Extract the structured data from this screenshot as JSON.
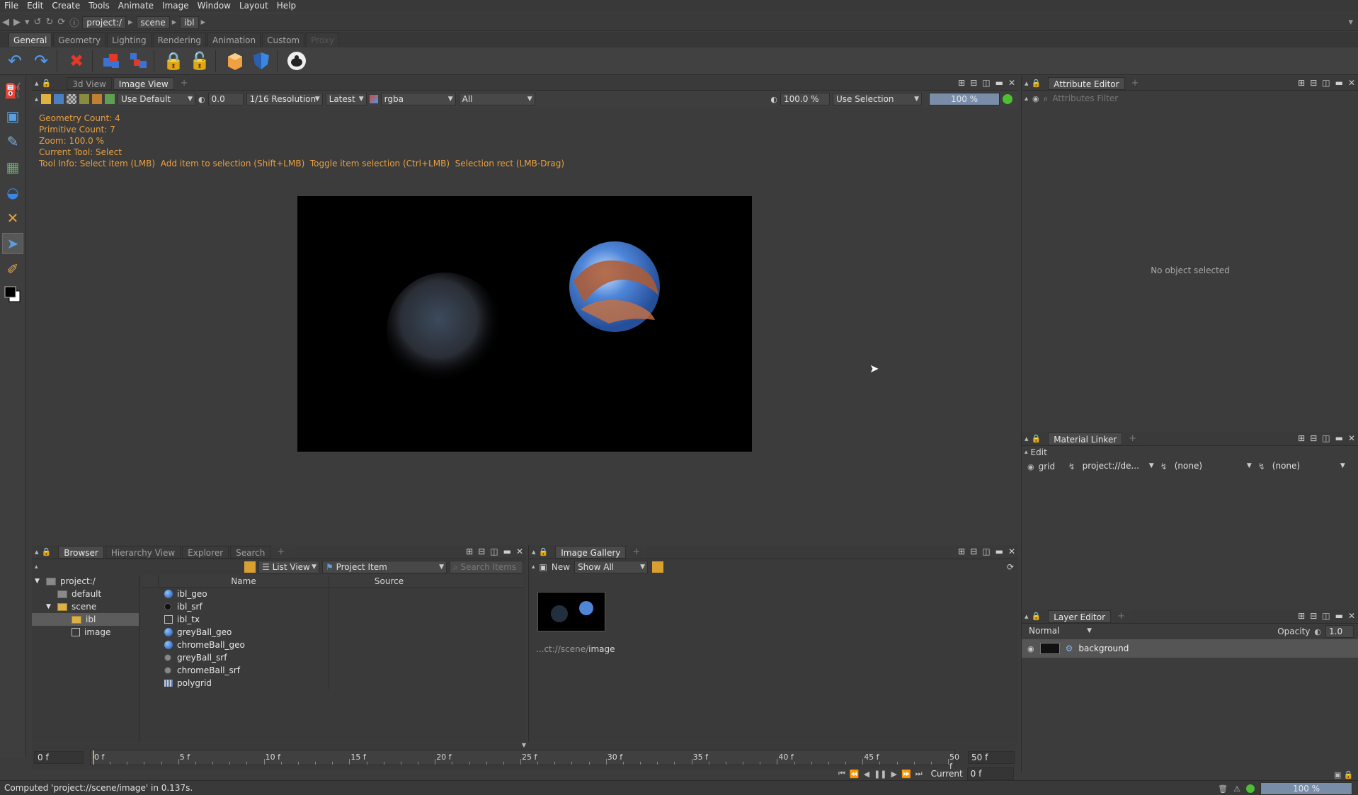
{
  "menu": [
    "File",
    "Edit",
    "Create",
    "Tools",
    "Animate",
    "Image",
    "Window",
    "Layout",
    "Help"
  ],
  "path": {
    "crumbs": [
      "project:/",
      "scene",
      "ibl"
    ]
  },
  "shelf_tabs": [
    {
      "label": "General",
      "active": true
    },
    {
      "label": "Geometry",
      "active": false
    },
    {
      "label": "Lighting",
      "active": false
    },
    {
      "label": "Rendering",
      "active": false
    },
    {
      "label": "Animation",
      "active": false
    },
    {
      "label": "Custom",
      "active": false
    },
    {
      "label": "Proxy",
      "active": false,
      "ghost": true
    }
  ],
  "toolbar_icons": [
    "undo-icon",
    "redo-icon",
    "delete-icon",
    "duplicate-icon",
    "group-icon",
    "lock-icon",
    "unlock-icon",
    "render-box-icon",
    "shield-icon",
    "teapot-icon"
  ],
  "left_tools": [
    "bucket-icon",
    "snap-icon",
    "eyedropper-icon",
    "image-tool-icon",
    "bowl-icon",
    "transform-icon",
    "select-icon",
    "brush-icon",
    "color-swatch-icon"
  ],
  "viewer": {
    "tabs": [
      {
        "label": "3d View",
        "active": false
      },
      {
        "label": "Image View",
        "active": true
      }
    ],
    "controls": {
      "lut": "Use Default",
      "exposure": "0.0",
      "resolution": "1/16 Resolution",
      "version": "Latest",
      "channel": "rgba",
      "layer": "All",
      "zoom": "100.0 %",
      "selection": "Use Selection",
      "progress_label": "100 %",
      "progress": 1.0
    },
    "overlay": [
      "Geometry Count: 4",
      "Primitive Count: 7",
      "Zoom: 100.0 %",
      "Current Tool: Select",
      "Tool Info: Select item (LMB)  Add item to selection (Shift+LMB)  Toggle item selection (Ctrl+LMB)  Selection rect (LMB-Drag)"
    ]
  },
  "attribute_editor": {
    "tab": "Attribute Editor",
    "filter_placeholder": "Attributes Filter",
    "empty": "No object selected"
  },
  "material_linker": {
    "tab": "Material Linker",
    "menu": "Edit",
    "row": {
      "name": "grid",
      "material": "project://de...",
      "shader": "(none)",
      "override": "(none)"
    }
  },
  "layer_editor": {
    "tab": "Layer Editor",
    "blend": "Normal",
    "opacity_label": "Opacity",
    "opacity": "1.0",
    "layers": [
      "background"
    ]
  },
  "browser": {
    "tabs": [
      {
        "label": "Browser",
        "active": true
      },
      {
        "label": "Hierarchy View",
        "active": false
      },
      {
        "label": "Explorer",
        "active": false
      },
      {
        "label": "Search",
        "active": false
      }
    ],
    "view_mode": "List View",
    "item_type": "Project Item",
    "search_placeholder": "Search Items",
    "tree": [
      {
        "label": "project:/",
        "depth": 0,
        "selected": false
      },
      {
        "label": "default",
        "depth": 1,
        "selected": false
      },
      {
        "label": "scene",
        "depth": 1,
        "selected": false
      },
      {
        "label": "ibl",
        "depth": 2,
        "selected": true
      },
      {
        "label": "image",
        "depth": 2,
        "selected": false
      }
    ],
    "columns": [
      "Name",
      "Source"
    ],
    "items": [
      {
        "name": "ibl_geo",
        "icon": "sphere-geo-icon"
      },
      {
        "name": "ibl_srf",
        "icon": "black-surface-icon"
      },
      {
        "name": "ibl_tx",
        "icon": "texture-icon"
      },
      {
        "name": "greyBall_geo",
        "icon": "sphere-geo-icon"
      },
      {
        "name": "chromeBall_geo",
        "icon": "sphere-geo-icon"
      },
      {
        "name": "greyBall_srf",
        "icon": "grey-surface-icon"
      },
      {
        "name": "chromeBall_srf",
        "icon": "grey-surface-icon"
      },
      {
        "name": "polygrid",
        "icon": "grid-icon"
      }
    ]
  },
  "gallery": {
    "tab": "Image Gallery",
    "new": "New",
    "filter": "Show All",
    "thumb_label_prefix": "...ct://scene/",
    "thumb_label_name": "image"
  },
  "timeline": {
    "start": "0 f",
    "end": "50 f",
    "ticks": [
      "0 f",
      "5 f",
      "10 f",
      "15 f",
      "20 f",
      "25 f",
      "30 f",
      "35 f",
      "40 f",
      "45 f",
      "50 f"
    ],
    "current_label": "Current",
    "current": "0 f"
  },
  "status": {
    "message": "Computed 'project://scene/image' in 0.137s.",
    "progress": "100 %"
  }
}
